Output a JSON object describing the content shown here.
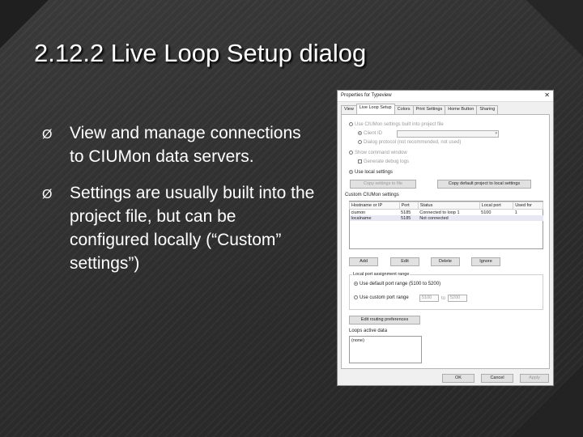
{
  "slide": {
    "title": "2.12.2  Live Loop Setup dialog",
    "bullet_glyph": "Ø",
    "bullets": [
      "View and manage connections to CIUMon data servers.",
      "Settings are usually built into the project file, but can be configured locally (“Custom” settings”)"
    ]
  },
  "dialog": {
    "title": "Properties for Typeview",
    "close": "✕",
    "tabs": [
      "View",
      "Live Loop Setup",
      "Colors",
      "Print Settings",
      "Home Button",
      "Sharing"
    ],
    "options": {
      "use_ciumon": "Use CIUMon settings built into project file",
      "client_id": "Client ID",
      "dialog_protocol": "Dialog protocol (not recommended, not used)",
      "show_cmd": "Show command window",
      "gen_logs": "Generate debug logs",
      "use_local": "Use local settings",
      "copy_to_file": "Copy settings to file",
      "copy_defaults": "Copy default project to local settings"
    },
    "custom_section": "Custom CIUMon settings",
    "table": {
      "headers": [
        "Hostname or IP",
        "Port",
        "Status",
        "Local port",
        "Used for"
      ],
      "rows": [
        [
          "ciumon",
          "5185",
          "Connected to loop 1",
          "5100",
          "1"
        ],
        [
          "localname",
          "5185",
          "Not connected",
          "",
          ""
        ]
      ]
    },
    "row_buttons": [
      "Add",
      "Edit",
      "Delete",
      "Ignore"
    ],
    "port_group": {
      "label": "Local port assignment range",
      "default_range": "Use default port range (5100 to 5200)",
      "custom_range": "Use custom port range",
      "from": "5100",
      "to_word": "to",
      "to": "5200"
    },
    "edit_routing": "Edit routing preferences",
    "loop_label": "Loops active data",
    "loop_value": "(none)",
    "footer": [
      "OK",
      "Cancel",
      "Apply"
    ]
  }
}
